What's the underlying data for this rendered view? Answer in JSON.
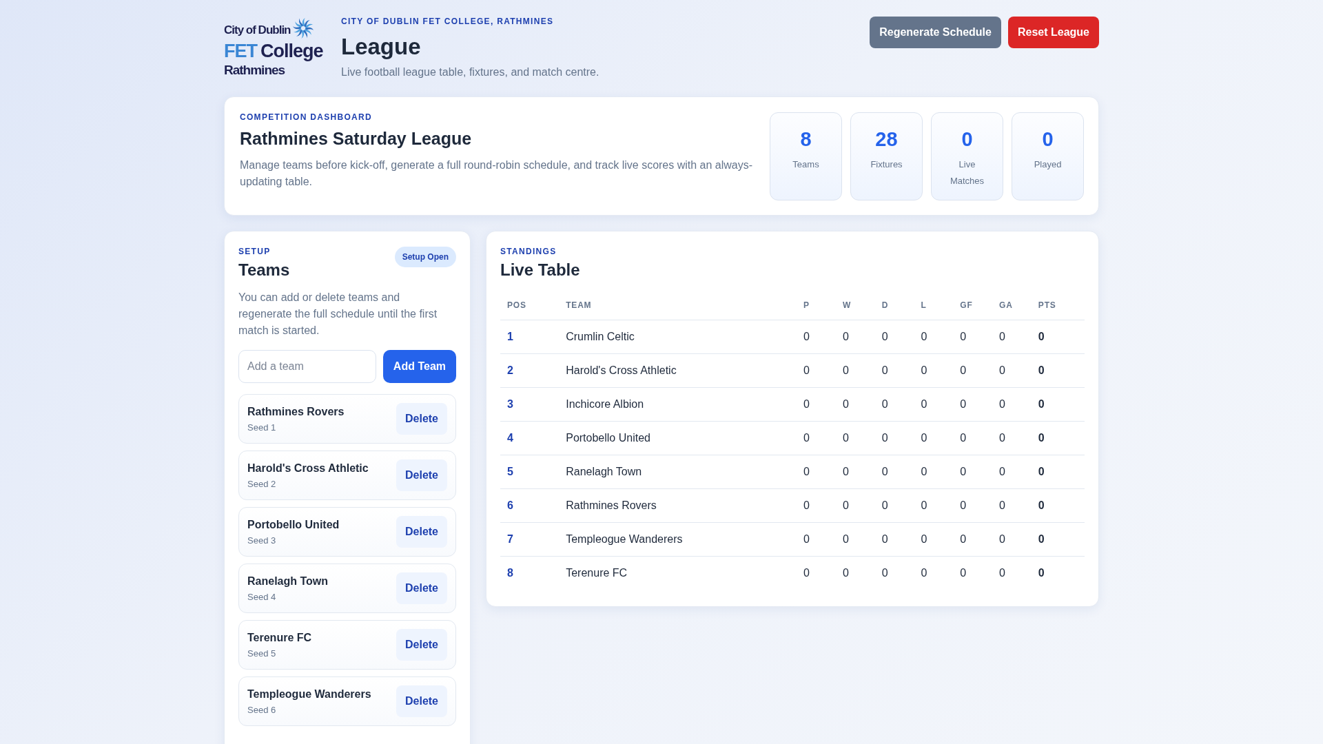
{
  "logo": {
    "line_1": "City of Dublin",
    "line_2a": "FET",
    "line_2b": "College",
    "line_3": "Rathmines"
  },
  "header": {
    "eyebrow": "CITY OF DUBLIN FET COLLEGE, RATHMINES",
    "title": "League",
    "subtitle": "Live football league table, fixtures, and match centre.",
    "buttons": [
      {
        "label": "Regenerate Schedule",
        "kind": "secondary"
      },
      {
        "label": "Reset League",
        "kind": "danger"
      }
    ]
  },
  "dashboard": {
    "eyebrow": "COMPETITION DASHBOARD",
    "title": "Rathmines Saturday League",
    "description": "Manage teams before kick-off, generate a full round-robin schedule, and track live scores with an always-updating table.",
    "stats": [
      {
        "value": "8",
        "label": "Teams"
      },
      {
        "value": "28",
        "label": "Fixtures"
      },
      {
        "value": "0",
        "label": "Live Matches"
      },
      {
        "value": "0",
        "label": "Played"
      }
    ]
  },
  "setup": {
    "eyebrow": "SETUP",
    "title": "Teams",
    "badge": "Setup Open",
    "description": "You can add or delete teams and regenerate the full schedule until the first match is started.",
    "input_placeholder": "Add a team",
    "add_button": "Add Team",
    "teams": [
      {
        "name": "Rathmines Rovers",
        "seed": "Seed 1",
        "action": "Delete"
      },
      {
        "name": "Harold's Cross Athletic",
        "seed": "Seed 2",
        "action": "Delete"
      },
      {
        "name": "Portobello United",
        "seed": "Seed 3",
        "action": "Delete"
      },
      {
        "name": "Ranelagh Town",
        "seed": "Seed 4",
        "action": "Delete"
      },
      {
        "name": "Terenure FC",
        "seed": "Seed 5",
        "action": "Delete"
      },
      {
        "name": "Templeogue Wanderers",
        "seed": "Seed 6",
        "action": "Delete"
      }
    ]
  },
  "standings": {
    "eyebrow": "STANDINGS",
    "title": "Live Table",
    "columns": [
      "POS",
      "TEAM",
      "P",
      "W",
      "D",
      "L",
      "GF",
      "GA",
      "PTS"
    ],
    "rows": [
      [
        "1",
        "Crumlin Celtic",
        "0",
        "0",
        "0",
        "0",
        "0",
        "0",
        "0"
      ],
      [
        "2",
        "Harold's Cross Athletic",
        "0",
        "0",
        "0",
        "0",
        "0",
        "0",
        "0"
      ],
      [
        "3",
        "Inchicore Albion",
        "0",
        "0",
        "0",
        "0",
        "0",
        "0",
        "0"
      ],
      [
        "4",
        "Portobello United",
        "0",
        "0",
        "0",
        "0",
        "0",
        "0",
        "0"
      ],
      [
        "5",
        "Ranelagh Town",
        "0",
        "0",
        "0",
        "0",
        "0",
        "0",
        "0"
      ],
      [
        "6",
        "Rathmines Rovers",
        "0",
        "0",
        "0",
        "0",
        "0",
        "0",
        "0"
      ],
      [
        "7",
        "Templeogue Wanderers",
        "0",
        "0",
        "0",
        "0",
        "0",
        "0",
        "0"
      ],
      [
        "8",
        "Terenure FC",
        "0",
        "0",
        "0",
        "0",
        "0",
        "0",
        "0"
      ]
    ]
  }
}
